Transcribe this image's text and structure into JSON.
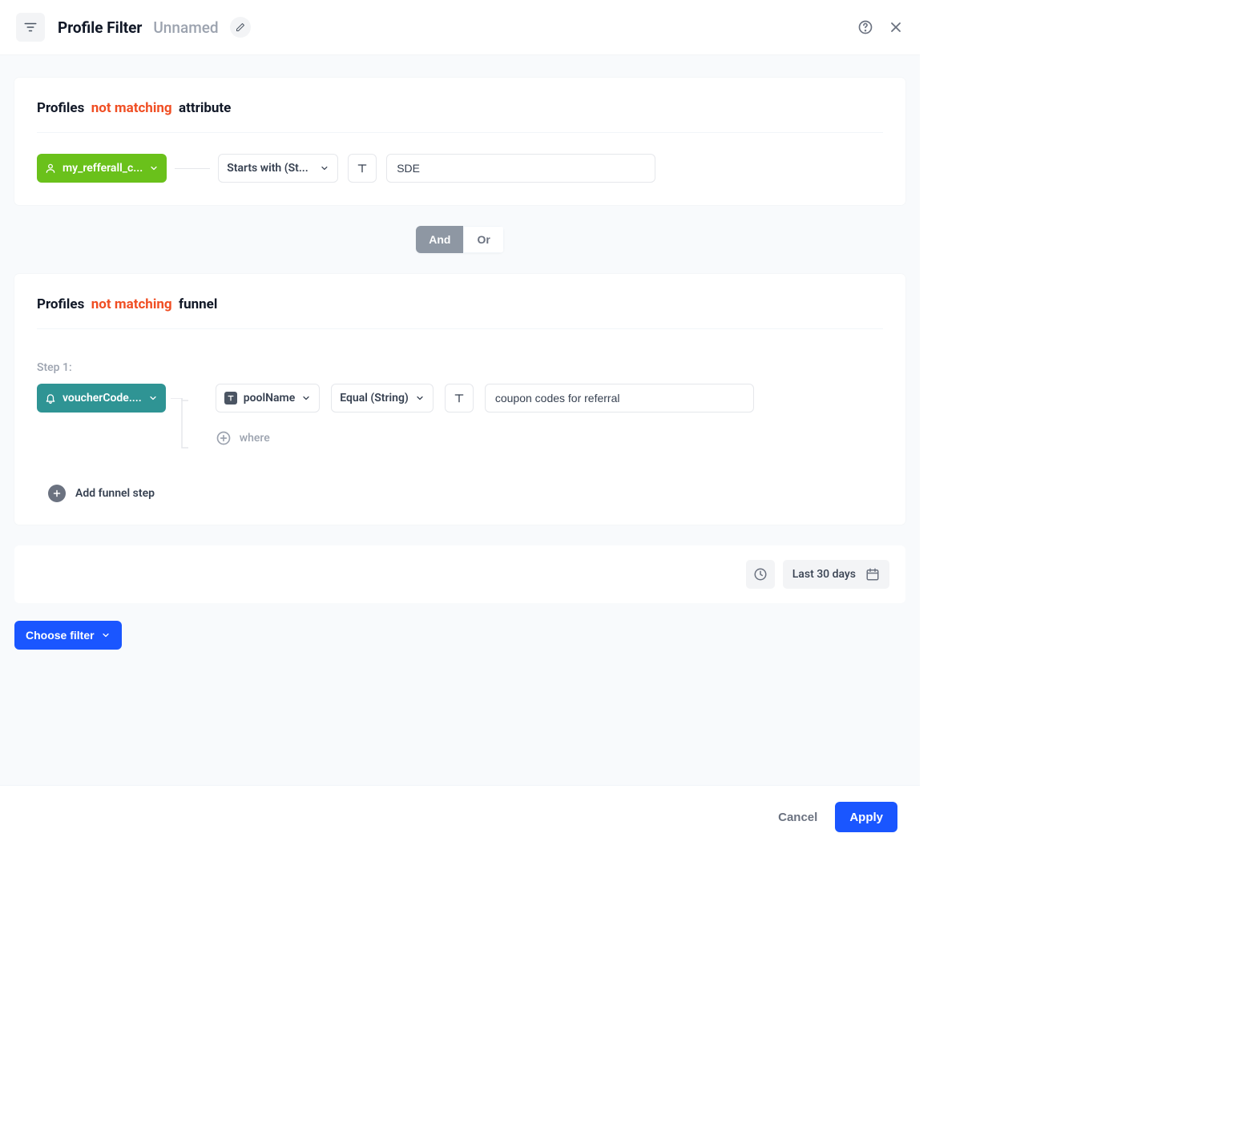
{
  "header": {
    "title": "Profile Filter",
    "subtitle": "Unnamed"
  },
  "section_attribute": {
    "heading_prefix": "Profiles",
    "heading_highlight": "not matching",
    "heading_suffix": "attribute",
    "attribute_chip": "my_refferall_c...",
    "operator": "Starts with (St...",
    "value": "SDE"
  },
  "andor": {
    "and": "And",
    "or": "Or"
  },
  "section_funnel": {
    "heading_prefix": "Profiles",
    "heading_highlight": "not matching",
    "heading_suffix": "funnel",
    "step_label": "Step 1:",
    "event_chip": "voucherCode....",
    "property": "poolName",
    "operator": "Equal (String)",
    "value": "coupon codes for referral",
    "where_label": "where",
    "add_step_label": "Add funnel step"
  },
  "date_range": "Last 30 days",
  "choose_filter": "Choose filter",
  "footer": {
    "cancel": "Cancel",
    "apply": "Apply"
  }
}
